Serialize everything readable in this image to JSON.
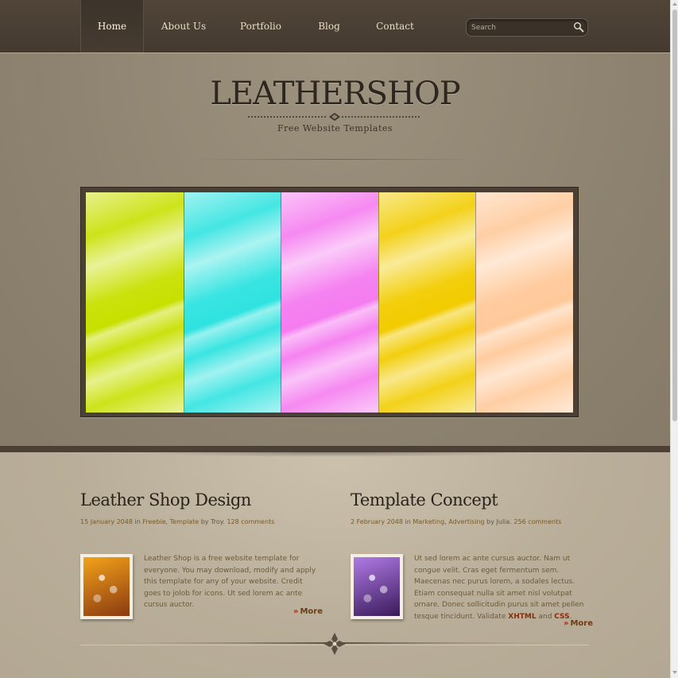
{
  "nav": {
    "items": [
      {
        "label": "Home",
        "active": true
      },
      {
        "label": "About Us",
        "active": false
      },
      {
        "label": "Portfolio",
        "active": false
      },
      {
        "label": "Blog",
        "active": false
      },
      {
        "label": "Contact",
        "active": false
      }
    ],
    "search": {
      "placeholder": "Search",
      "icon": "magnifier-icon"
    }
  },
  "header": {
    "logo": "LEATHERSHOP",
    "tagline": "Free Website Templates",
    "slider": {
      "slides": [
        {
          "color": "#c8e000"
        },
        {
          "color": "#2fe3e0"
        },
        {
          "color": "#f57cf0"
        },
        {
          "color": "#f2cc00"
        },
        {
          "color": "#ffc99a"
        }
      ]
    }
  },
  "posts": [
    {
      "title": "Leather Shop Design",
      "meta": {
        "date": "15 January 2048",
        "in": "in",
        "categories": [
          "Freebie",
          "Template"
        ],
        "by": "by",
        "author": "Troy",
        "comments": "128 comments"
      },
      "body": "Leather Shop is a free website template for everyone. You may download, modify and apply this template for any of your website. Credit goes to jolob for icons. Ut sed lorem ac ante cursus auctor.",
      "more": "More",
      "thumb_colors": [
        "#f3a21a",
        "#8a3a10"
      ]
    },
    {
      "title": "Template Concept",
      "meta": {
        "date": "2 February 2048",
        "in": "in",
        "categories": [
          "Marketing",
          "Advertising"
        ],
        "by": "by",
        "author": "Julia",
        "comments": "256 comments"
      },
      "body_parts": {
        "text": "Ut sed lorem ac ante cursus auctor. Nam ut congue velit. Cras eget fermentum sem. Maecenas nec purus lorem, a sodales lectus. Etiam consequat nulla sit amet nisl volutpat ornare. Donec sollicitudin purus sit amet pellen tesque tincidunt. Validate",
        "xhtml": "XHTML",
        "and": "and",
        "css": "CSS",
        "end": "."
      },
      "more": "More",
      "thumb_colors": [
        "#b07be6",
        "#3a1a5a"
      ]
    }
  ],
  "colors": {
    "nav_bg": "#4a4035",
    "header_bg": "#8f8572",
    "content_bg": "#b9ae99",
    "accent": "#7a5a24"
  }
}
